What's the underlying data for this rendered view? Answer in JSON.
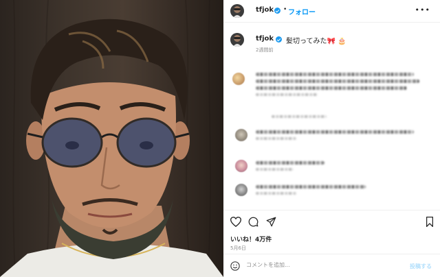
{
  "post": {
    "username": "tfjok",
    "follow_label": "フォロー",
    "separator": "•",
    "more_label": "•••"
  },
  "caption": {
    "username": "tfjok",
    "text": "髪切ってみた🎀 🎂",
    "time": "2週間前"
  },
  "actions": {
    "likes": "いいね！4万件",
    "date": "5月6日"
  },
  "comment_box": {
    "placeholder": "コメントを追加...",
    "post_label": "投稿する"
  },
  "colors": {
    "accent": "#0095f6",
    "verified": "#1d9bf0",
    "post_disabled": "#b2dffc"
  },
  "icons": [
    "verified-badge-icon",
    "more-options-icon",
    "heart-icon",
    "comment-icon",
    "share-icon",
    "bookmark-icon",
    "emoji-icon"
  ]
}
